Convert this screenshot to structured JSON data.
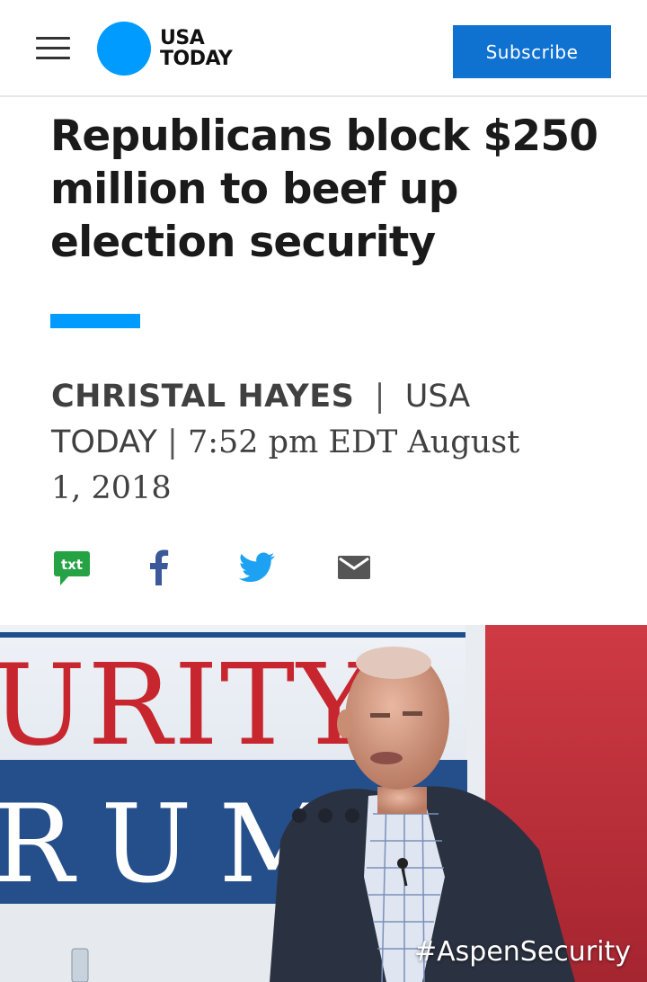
{
  "header": {
    "logo_line1": "USA",
    "logo_line2": "TODAY",
    "subscribe_label": "Subscribe",
    "brand_color": "#009bff",
    "subscribe_color": "#0f72d1"
  },
  "article": {
    "headline": "Republicans block $250 million to beef up election security",
    "author": "CHRISTAL HAYES",
    "separator": "|",
    "publication_line1": "USA",
    "publication_line2": "TODAY",
    "datetime_line1": "7:52 pm EDT August",
    "datetime_line2": "1, 2018"
  },
  "share": {
    "txt_label": "txt",
    "icons": [
      "txt-icon",
      "facebook-icon",
      "twitter-icon",
      "mail-icon"
    ]
  },
  "photo": {
    "backdrop_row1": "URITY",
    "backdrop_row2": "RUM",
    "caption": "#AspenSecurity"
  }
}
